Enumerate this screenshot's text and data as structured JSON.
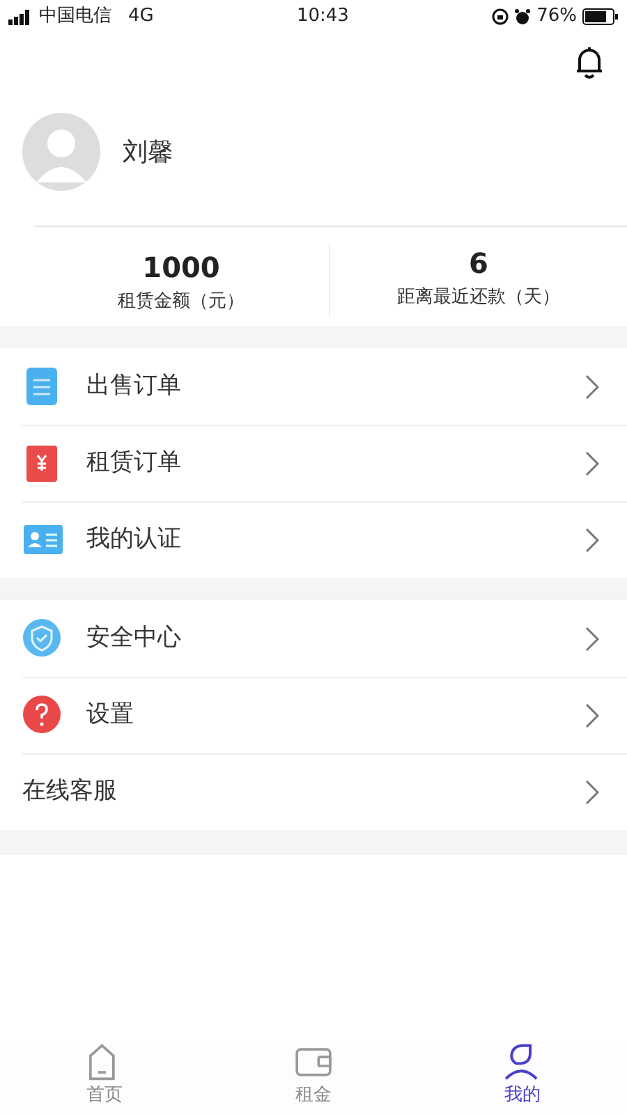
{
  "status_bar": {
    "carrier": "中国电信",
    "network": "4G",
    "time": "10:43",
    "battery": "76%"
  },
  "profile": {
    "name": "刘馨"
  },
  "stats": [
    {
      "value": "1000",
      "label": "租赁金额（元）"
    },
    {
      "value": "6",
      "label": "距离最近还款（天）"
    }
  ],
  "menu_groups": [
    [
      {
        "kind": "doc",
        "label": "出售订单"
      },
      {
        "kind": "receipt",
        "label": "租赁订单"
      },
      {
        "kind": "id-card",
        "label": "我的认证"
      }
    ],
    [
      {
        "kind": "shield",
        "label": "安全中心"
      },
      {
        "kind": "help",
        "label": "设置"
      },
      {
        "kind": "plain",
        "label": "在线客服"
      }
    ]
  ],
  "tab_bar": [
    {
      "kind": "home",
      "label": "首页",
      "selected": false
    },
    {
      "kind": "wallet",
      "label": "租金",
      "selected": false
    },
    {
      "kind": "person",
      "label": "我的",
      "selected": true
    }
  ]
}
